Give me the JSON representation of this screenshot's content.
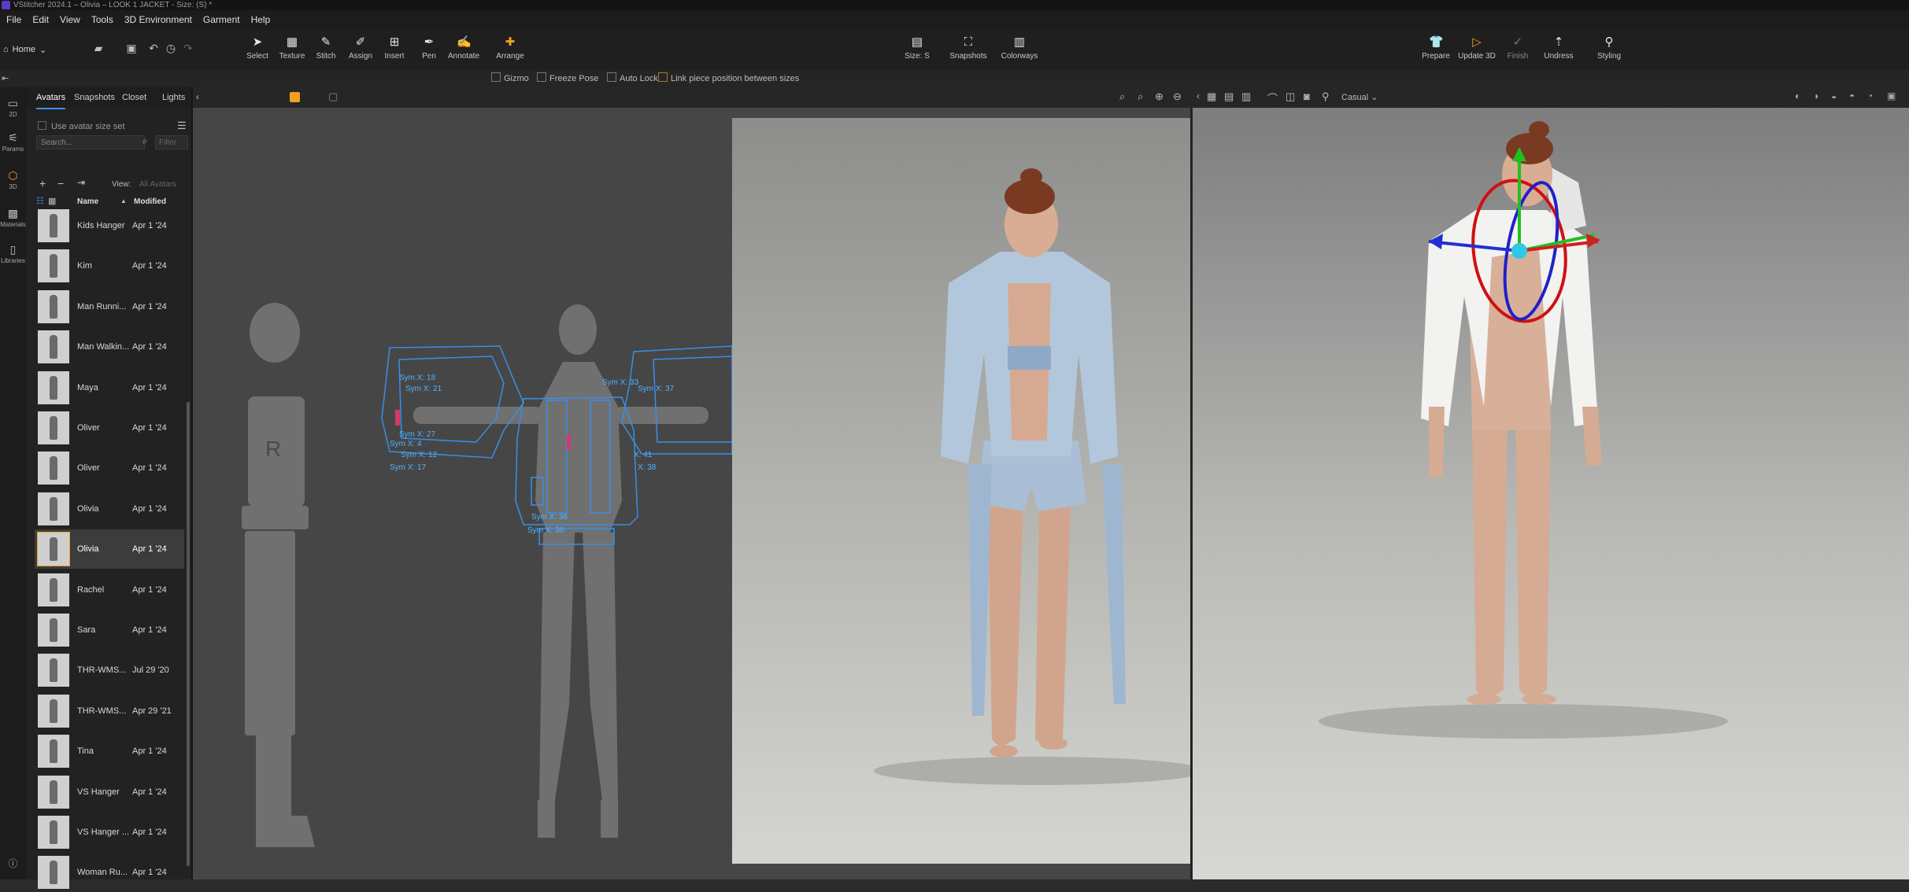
{
  "window": {
    "title": "VStitcher 2024.1 – Olivia – LOOK 1 JACKET - Size: (S) *"
  },
  "menu": [
    "File",
    "Edit",
    "View",
    "Tools",
    "3D Environment",
    "Garment",
    "Help"
  ],
  "home": {
    "label": "Home"
  },
  "toolbar": {
    "left_tools": [
      {
        "label": "Select",
        "icon": "cursor-icon"
      },
      {
        "label": "Texture",
        "icon": "texture-icon"
      },
      {
        "label": "Stitch",
        "icon": "stitch-icon"
      },
      {
        "label": "Assign",
        "icon": "assign-icon"
      },
      {
        "label": "Insert",
        "icon": "insert-icon"
      },
      {
        "label": "Pen",
        "icon": "pen-icon"
      },
      {
        "label": "Annotate",
        "icon": "annotate-icon"
      },
      {
        "label": "Arrange",
        "icon": "arrange-icon",
        "active": true
      }
    ],
    "center_tools": [
      {
        "label": "Size: S"
      },
      {
        "label": "Snapshots"
      },
      {
        "label": "Colorways"
      }
    ],
    "right_tools": [
      {
        "label": "Prepare"
      },
      {
        "label": "Update 3D"
      },
      {
        "label": "Finish"
      },
      {
        "label": "Undress"
      },
      {
        "label": "Styling"
      }
    ],
    "accent_color": "#f0a020"
  },
  "options": {
    "gizmo": "Gizmo",
    "freeze_pose": "Freeze Pose",
    "auto_lock": "Auto Lock",
    "link_piece": "Link piece position between sizes"
  },
  "rail": [
    {
      "label": "2D",
      "icon": "2d-icon"
    },
    {
      "label": "Params",
      "icon": "params-icon"
    },
    {
      "label": "3D",
      "icon": "3d-cube-icon",
      "active": true
    },
    {
      "label": "Materials",
      "icon": "materials-icon"
    },
    {
      "label": "Libraries",
      "icon": "libraries-icon"
    }
  ],
  "panel": {
    "tabs": [
      "Avatars",
      "Snapshots",
      "Closet",
      "Lights"
    ],
    "use_avatar_size_set": "Use avatar size set",
    "search_placeholder": "Search...",
    "filter_placeholder": "Filter",
    "view_label": "View:",
    "view_value": "All Avatars",
    "columns": {
      "name": "Name",
      "modified": "Modified"
    },
    "items": [
      {
        "name": "Kids Hanger",
        "modified": "Apr 1 '24"
      },
      {
        "name": "Kim",
        "modified": "Apr 1 '24"
      },
      {
        "name": "Man Runni...",
        "modified": "Apr 1 '24"
      },
      {
        "name": "Man Walkin...",
        "modified": "Apr 1 '24"
      },
      {
        "name": "Maya",
        "modified": "Apr 1 '24"
      },
      {
        "name": "Oliver",
        "modified": "Apr 1 '24"
      },
      {
        "name": "Oliver",
        "modified": "Apr 1 '24"
      },
      {
        "name": "Olivia",
        "modified": "Apr 1 '24"
      },
      {
        "name": "Olivia",
        "modified": "Apr 1 '24",
        "selected": true
      },
      {
        "name": "Rachel",
        "modified": "Apr 1 '24"
      },
      {
        "name": "Sara",
        "modified": "Apr 1 '24"
      },
      {
        "name": "THR-WMS...",
        "modified": "Jul 29 '20"
      },
      {
        "name": "THR-WMS...",
        "modified": "Apr 29 '21"
      },
      {
        "name": "Tina",
        "modified": "Apr 1 '24"
      },
      {
        "name": "VS Hanger",
        "modified": "Apr 1 '24"
      },
      {
        "name": "VS Hanger ...",
        "modified": "Apr 1 '24"
      },
      {
        "name": "Woman Ru...",
        "modified": "Apr 1 '24"
      }
    ]
  },
  "view3d": {
    "environment": "Casual"
  },
  "pattern_labels": [
    "Sym X: 18",
    "Sym X: 21",
    "Sym X: 27",
    "Sym X: 4",
    "Sym X: 12",
    "Sym X: 17",
    "Sym X: 33",
    "Sym X: 37",
    "X: 41",
    "X: 38",
    "R",
    "Sym X: 36",
    "Sym X: 30"
  ]
}
